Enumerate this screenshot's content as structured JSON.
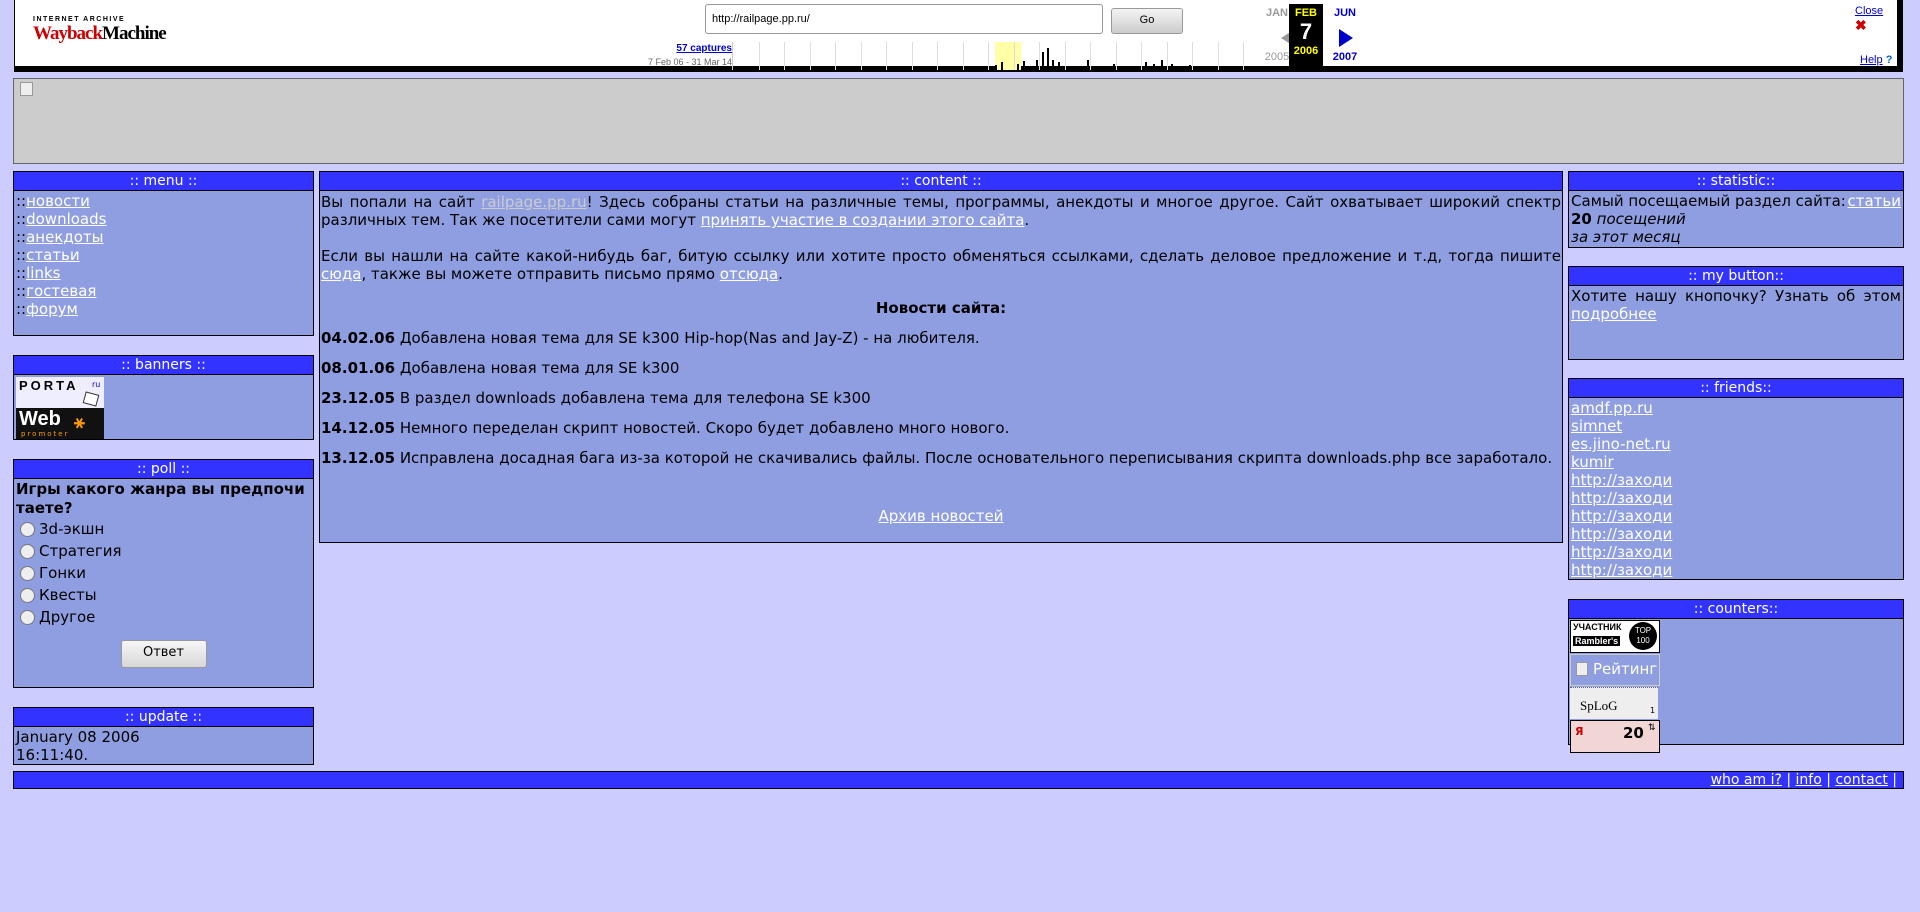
{
  "wayback": {
    "logo_top": "INTERNET ARCHIVE",
    "logo_wayback": "Wayback",
    "logo_machine": "Machine",
    "url_value": "http://railpage.pp.ru/",
    "go_label": "Go",
    "captures_label": "57 captures",
    "range_label": "7 Feb 06 - 31 Mar 14",
    "prev_month": "JAN",
    "cur_month": "FEB",
    "cur_day": "7",
    "cur_year": "2006",
    "next_month": "JUN",
    "prev_year": "2005",
    "next_year": "2007",
    "close_label": "Close",
    "help_label": "Help"
  },
  "menu": {
    "header": ":: menu ::",
    "prefix": "::",
    "items": [
      "новости",
      "downloads",
      "анекдоты",
      "статьи",
      "links",
      "гостевая",
      "форум"
    ]
  },
  "banners": {
    "header": ":: banners ::",
    "porta_label": "PORTA",
    "porta_suffix": "ru",
    "web_label": "Web",
    "web_sub": "promoter"
  },
  "poll": {
    "header": ":: poll ::",
    "question": "Игры какого жанра вы предпочитаете?",
    "options": [
      "3d-экшн",
      "Стратегия",
      "Гонки",
      "Квесты",
      "Другое"
    ],
    "submit_label": "Ответ"
  },
  "update": {
    "header": ":: update ::",
    "date": "January 08 2006",
    "time": "16:11:40."
  },
  "content": {
    "header": ":: content ::",
    "intro_1": "Вы попали на сайт ",
    "intro_link": "railpage.pp.ru",
    "intro_2": "! Здесь собраны статьи на различные темы, программы, анекдоты и многое другое. Сайт охватывает широкий спектр различных тем. Так же посетители сами могут ",
    "intro_link2": "принять участие в создании этого сайта",
    "intro_3": ".",
    "contact_1": "Если вы нашли на сайте какой-нибудь баг, битую ссылку или хотите просто обменяться ссылками, сделать деловое предложение и т.д, тогда пишите ",
    "contact_link1": "сюда",
    "contact_2": ", также вы можете отправить письмо прямо ",
    "contact_link2": "отсюда",
    "contact_3": ".",
    "news_title": "Новости сайта:",
    "news": [
      {
        "date": "04.02.06",
        "text": "Добавлена новая тема для SE k300 Hip-hop(Nas and Jay-Z) - на любителя."
      },
      {
        "date": "08.01.06",
        "text": "Добавлена новая тема для SE k300"
      },
      {
        "date": "23.12.05",
        "text": "В раздел downloads добавлена тема для телефона SE k300"
      },
      {
        "date": "14.12.05",
        "text": "Немного переделан скрипт новостей. Скоро будет добавлено много нового."
      },
      {
        "date": "13.12.05",
        "text": "Исправлена досадная бага из-за которой не скачивались файлы. После основательного переписывания скрипта downloads.php все заработало."
      }
    ],
    "archive_link": "Архив новостей"
  },
  "statistic": {
    "header": ":: statistic::",
    "text": "Самый посещаемый раздел сайта: ",
    "link": " статьи",
    "count": "20",
    "count_text": " посещений",
    "period": "за этот месяц"
  },
  "mybutton": {
    "header": ":: my button::",
    "text": "Хотите нашу кнопочку? Узнать об этом ",
    "link": "подробнее"
  },
  "friends": {
    "header": ":: friends::",
    "items": [
      "amdf.pp.ru",
      "simnet",
      "es.jino-net.ru",
      "kumir",
      "http://заходи",
      "http://заходи",
      "http://заходи",
      "http://заходи",
      "http://заходи",
      "http://заходи"
    ]
  },
  "counters": {
    "header": ":: counters::",
    "rambler_1": "УЧАСТНИК",
    "rambler_2": "Rambler's",
    "rambler_top": "TOP",
    "rambler_100": "100",
    "rating": "Рейтинг",
    "splog": "SpLoG",
    "splog_num": "1",
    "ya_num": "20"
  },
  "footer": {
    "links": [
      "who am i?",
      "info",
      "contact"
    ],
    "sep": " | ",
    "end": " |"
  }
}
